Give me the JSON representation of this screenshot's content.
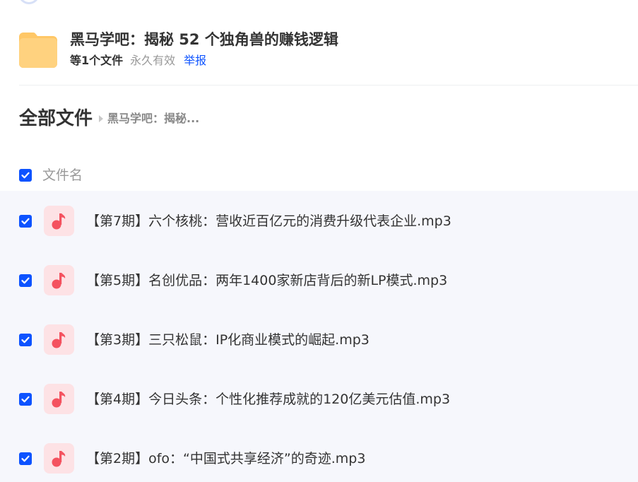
{
  "share": {
    "title": "黑马学吧：揭秘 52 个独角兽的赚钱逻辑",
    "file_count": "等1个文件",
    "validity": "永久有效",
    "report_label": "举报"
  },
  "breadcrumb": {
    "root": "全部文件",
    "current": "黑马学吧：揭秘..."
  },
  "list_header": {
    "column_name": "文件名",
    "select_all_checked": true
  },
  "files": [
    {
      "name": "【第7期】六个核桃：营收近百亿元的消费升级代表企业.mp3",
      "checked": true,
      "icon": "music-icon"
    },
    {
      "name": "【第5期】名创优品：两年1400家新店背后的新LP模式.mp3",
      "checked": true,
      "icon": "music-icon"
    },
    {
      "name": "【第3期】三只松鼠：IP化商业模式的崛起.mp3",
      "checked": true,
      "icon": "music-icon"
    },
    {
      "name": "【第4期】今日头条：个性化推荐成就的120亿美元估值.mp3",
      "checked": true,
      "icon": "music-icon"
    },
    {
      "name": "【第2期】ofo：“中国式共享经济”的奇迹.mp3",
      "checked": true,
      "icon": "music-icon"
    }
  ],
  "colors": {
    "accent": "#0d53ff",
    "folder": "#ffc766",
    "music_icon_bg": "#fde2e5",
    "music_icon_fg": "#f4525f",
    "list_bg": "#f6f7fc"
  }
}
